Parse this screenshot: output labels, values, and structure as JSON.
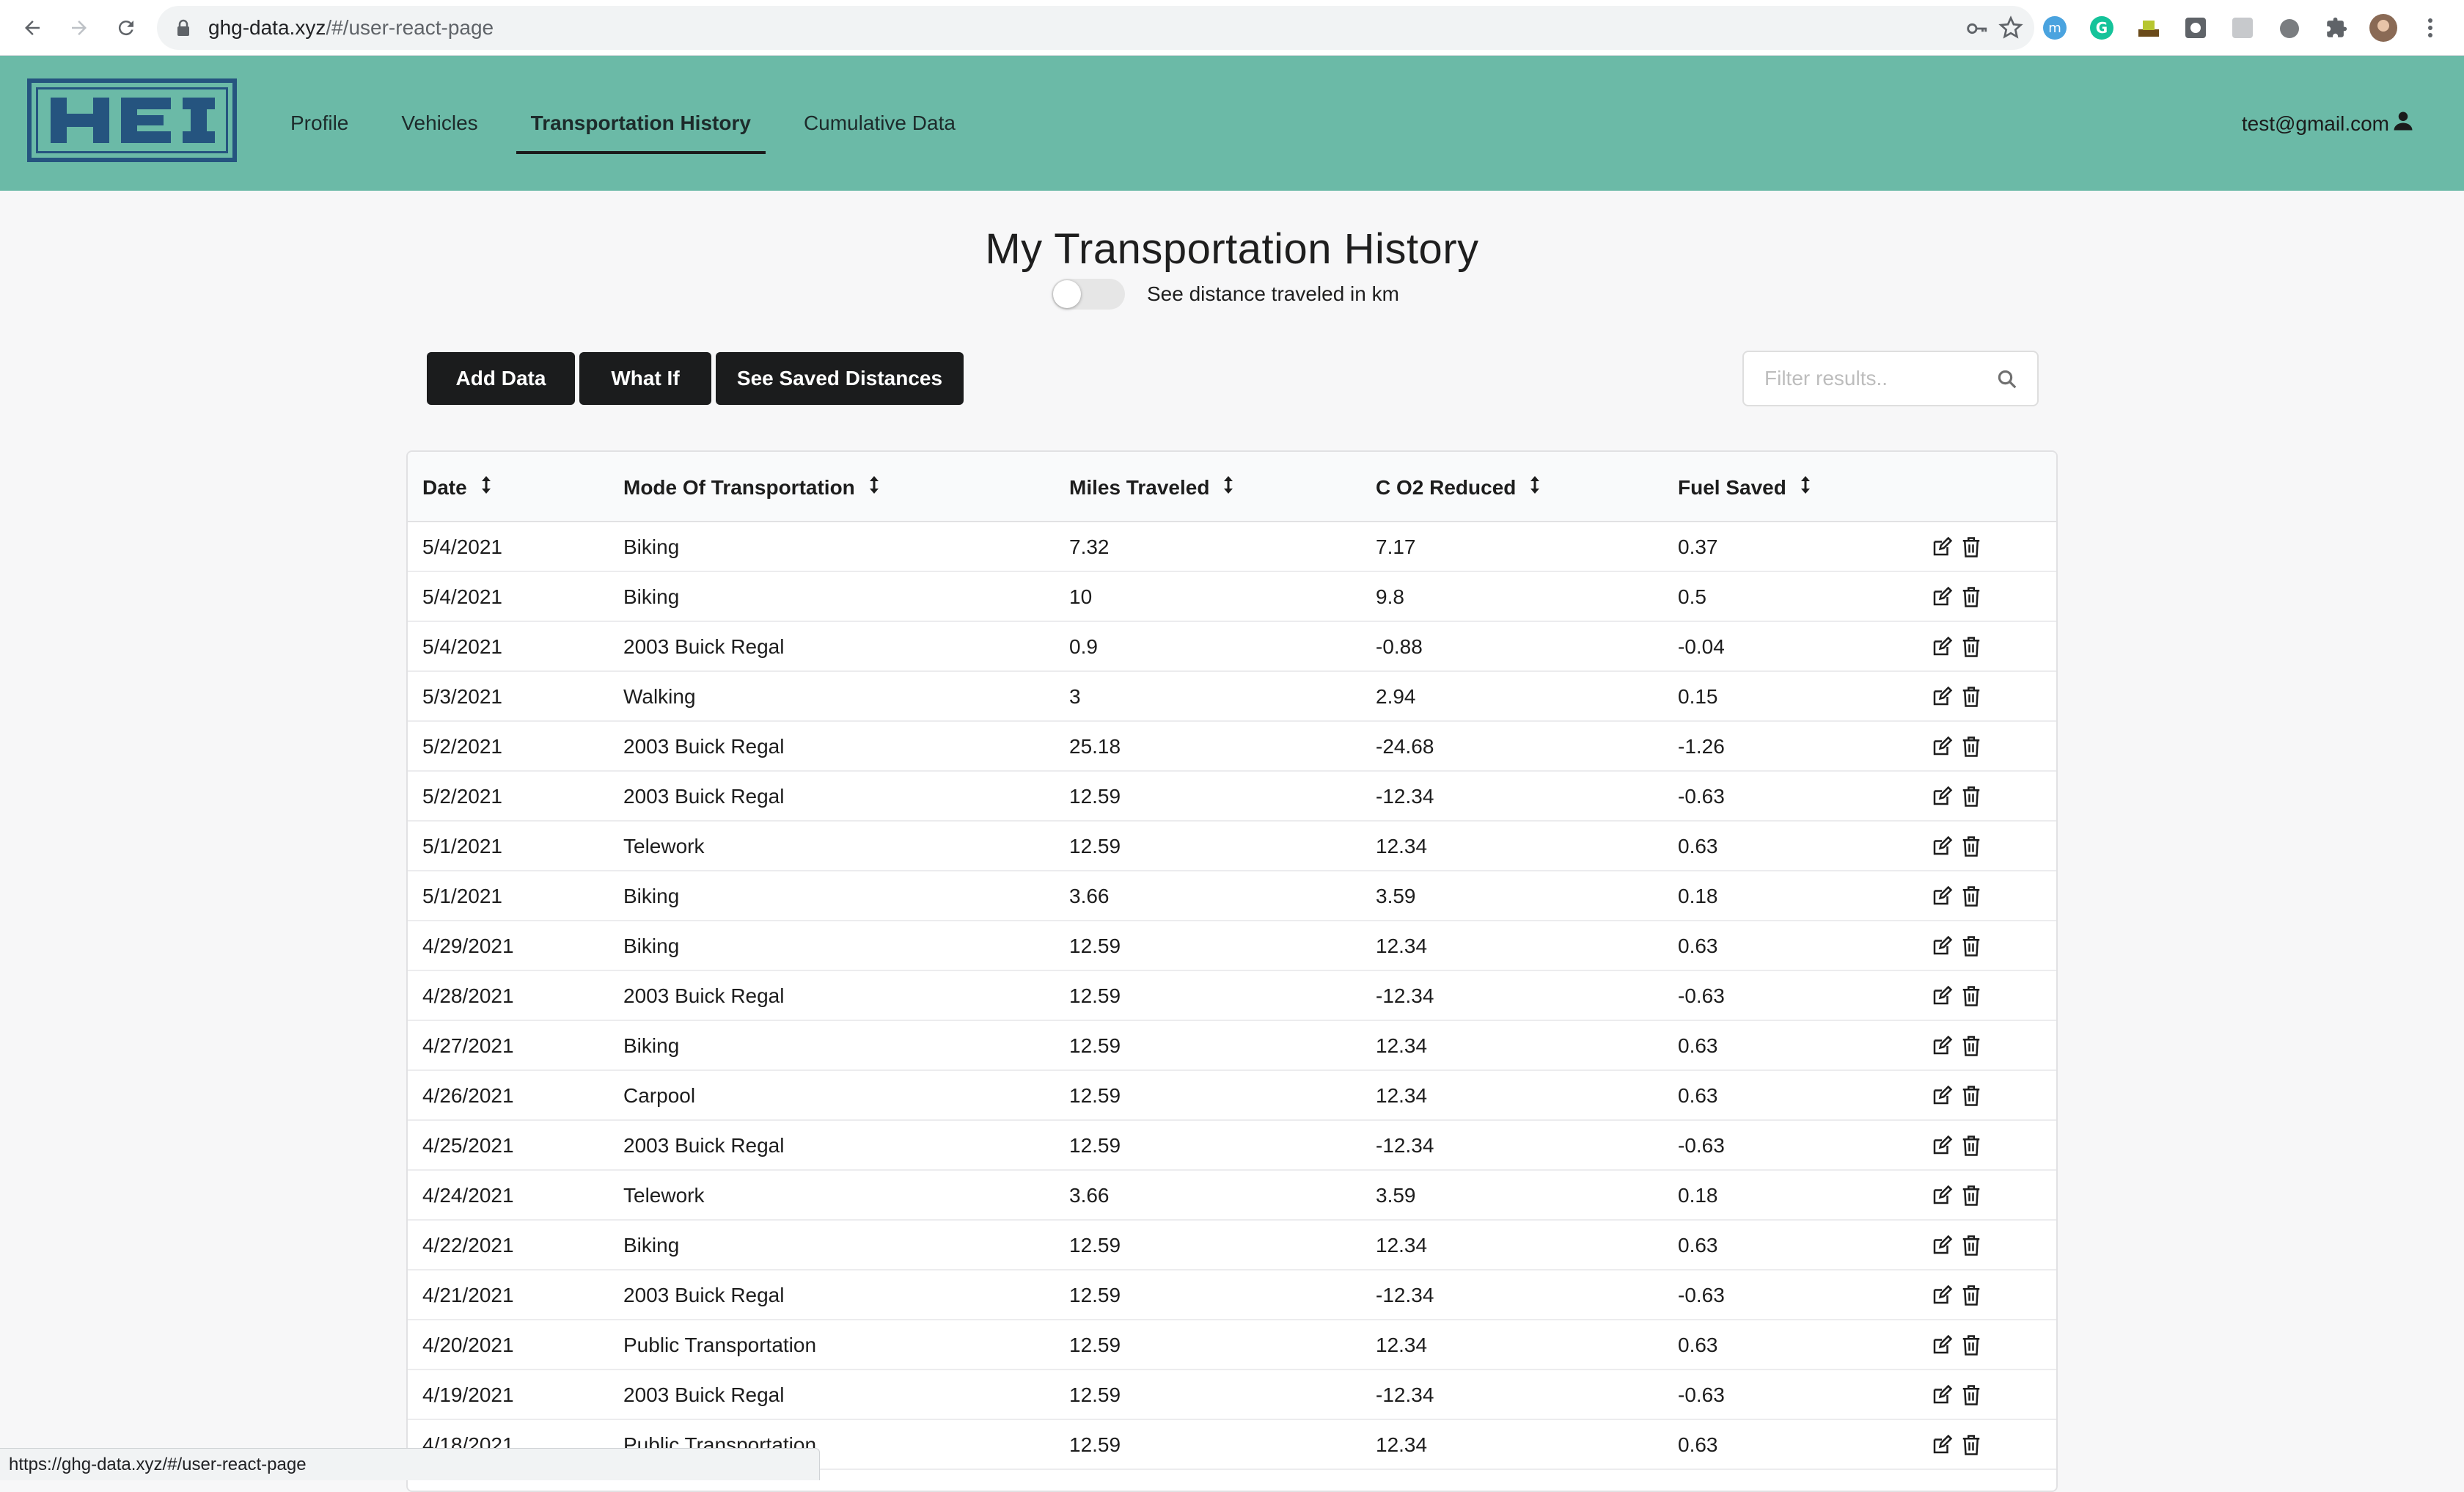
{
  "browser": {
    "url_host": "ghg-data.xyz",
    "url_path": "/#/user-react-page",
    "status_url": "https://ghg-data.xyz/#/user-react-page"
  },
  "header": {
    "logo_text": "HEI",
    "nav": [
      {
        "label": "Profile",
        "active": false
      },
      {
        "label": "Vehicles",
        "active": false
      },
      {
        "label": "Transportation History",
        "active": true
      },
      {
        "label": "Cumulative Data",
        "active": false
      }
    ],
    "user_email": "test@gmail.com"
  },
  "main": {
    "title": "My Transportation History",
    "toggle_label": "See distance traveled in km",
    "toggle_on": false,
    "buttons": {
      "add_data": "Add Data",
      "what_if": "What If",
      "saved_distances": "See Saved Distances"
    },
    "filter_placeholder": "Filter results.."
  },
  "table": {
    "columns": [
      "Date",
      "Mode Of Transportation",
      "Miles Traveled",
      "C O2 Reduced",
      "Fuel Saved"
    ],
    "rows": [
      [
        "5/4/2021",
        "Biking",
        "7.32",
        "7.17",
        "0.37"
      ],
      [
        "5/4/2021",
        "Biking",
        "10",
        "9.8",
        "0.5"
      ],
      [
        "5/4/2021",
        "2003 Buick Regal",
        "0.9",
        "-0.88",
        "-0.04"
      ],
      [
        "5/3/2021",
        "Walking",
        "3",
        "2.94",
        "0.15"
      ],
      [
        "5/2/2021",
        "2003 Buick Regal",
        "25.18",
        "-24.68",
        "-1.26"
      ],
      [
        "5/2/2021",
        "2003 Buick Regal",
        "12.59",
        "-12.34",
        "-0.63"
      ],
      [
        "5/1/2021",
        "Telework",
        "12.59",
        "12.34",
        "0.63"
      ],
      [
        "5/1/2021",
        "Biking",
        "3.66",
        "3.59",
        "0.18"
      ],
      [
        "4/29/2021",
        "Biking",
        "12.59",
        "12.34",
        "0.63"
      ],
      [
        "4/28/2021",
        "2003 Buick Regal",
        "12.59",
        "-12.34",
        "-0.63"
      ],
      [
        "4/27/2021",
        "Biking",
        "12.59",
        "12.34",
        "0.63"
      ],
      [
        "4/26/2021",
        "Carpool",
        "12.59",
        "12.34",
        "0.63"
      ],
      [
        "4/25/2021",
        "2003 Buick Regal",
        "12.59",
        "-12.34",
        "-0.63"
      ],
      [
        "4/24/2021",
        "Telework",
        "3.66",
        "3.59",
        "0.18"
      ],
      [
        "4/22/2021",
        "Biking",
        "12.59",
        "12.34",
        "0.63"
      ],
      [
        "4/21/2021",
        "2003 Buick Regal",
        "12.59",
        "-12.34",
        "-0.63"
      ],
      [
        "4/20/2021",
        "Public Transportation",
        "12.59",
        "12.34",
        "0.63"
      ],
      [
        "4/19/2021",
        "2003 Buick Regal",
        "12.59",
        "-12.34",
        "-0.63"
      ],
      [
        "4/18/2021",
        "Public Transportation",
        "12.59",
        "12.34",
        "0.63"
      ]
    ]
  },
  "colors": {
    "header_bg": "#6bbaa7",
    "logo_blue": "#25547f",
    "button_bg": "#1b1c1d"
  }
}
